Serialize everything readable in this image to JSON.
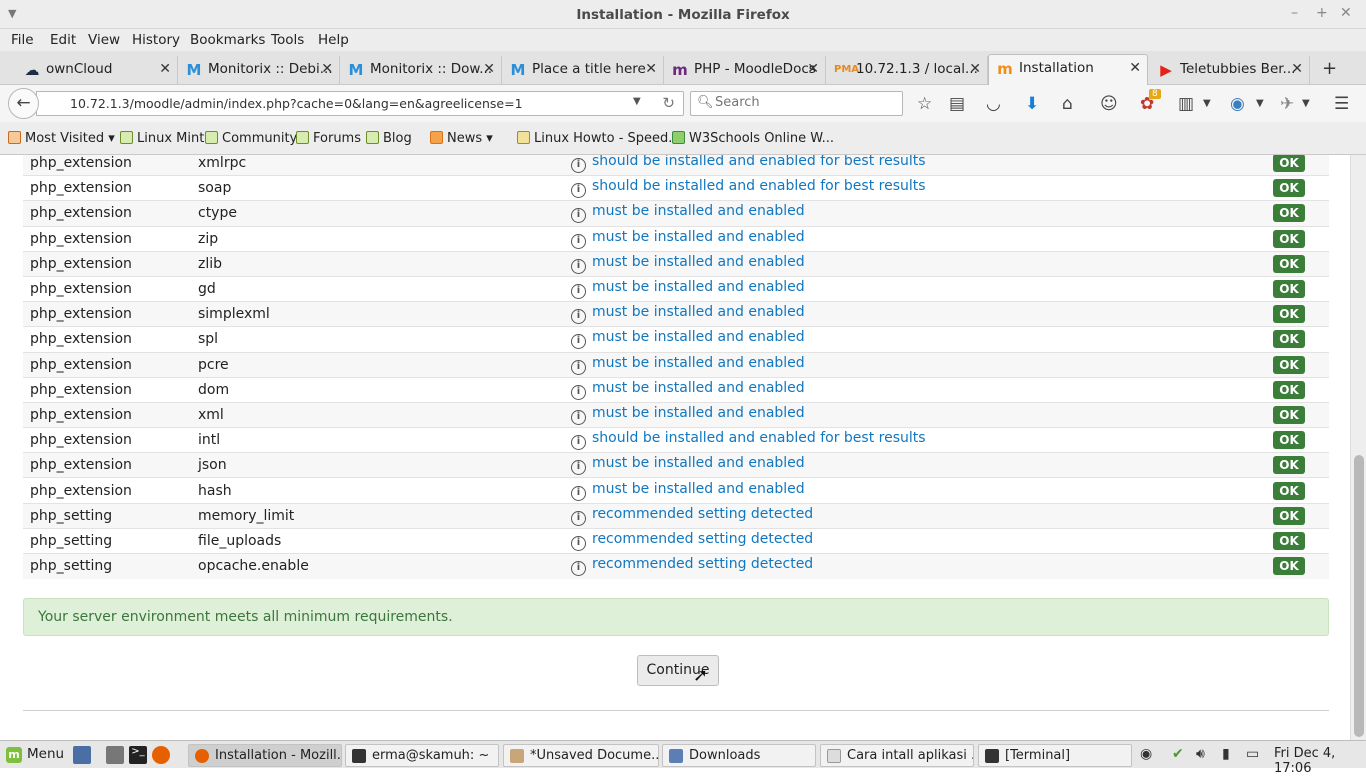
{
  "window": {
    "title": "Installation - Mozilla Firefox"
  },
  "menubar": [
    "File",
    "Edit",
    "View",
    "History",
    "Bookmarks",
    "Tools",
    "Help"
  ],
  "tabs": [
    {
      "label": "ownCloud",
      "icon": "cloud-icon"
    },
    {
      "label": "Monitorix :: Debi...",
      "icon": "monitorix-icon"
    },
    {
      "label": "Monitorix :: Dow...",
      "icon": "monitorix-icon"
    },
    {
      "label": "Place a title here",
      "icon": "monitorix-icon"
    },
    {
      "label": "PHP - MoodleDocs",
      "icon": "moodledocs-icon"
    },
    {
      "label": "10.72.1.3 / local...",
      "icon": "phpmyadmin-icon"
    },
    {
      "label": "Installation",
      "icon": "moodle-icon",
      "active": true
    },
    {
      "label": "Teletubbies Ber...",
      "icon": "youtube-icon"
    }
  ],
  "navbar": {
    "url": "10.72.1.3/moodle/admin/index.php?cache=0&lang=en&agreelicense=1",
    "search_placeholder": "Search",
    "badge_count": "8"
  },
  "bookmarks": [
    "Most Visited",
    "Linux Mint",
    "Community",
    "Forums",
    "Blog",
    "News",
    "Linux Howto - Speed...",
    "W3Schools Online W..."
  ],
  "requirements": [
    {
      "type": "php_extension",
      "name": "xmlrpc",
      "status": "should be installed and enabled for best results",
      "result": "OK"
    },
    {
      "type": "php_extension",
      "name": "soap",
      "status": "should be installed and enabled for best results",
      "result": "OK"
    },
    {
      "type": "php_extension",
      "name": "ctype",
      "status": "must be installed and enabled",
      "result": "OK"
    },
    {
      "type": "php_extension",
      "name": "zip",
      "status": "must be installed and enabled",
      "result": "OK"
    },
    {
      "type": "php_extension",
      "name": "zlib",
      "status": "must be installed and enabled",
      "result": "OK"
    },
    {
      "type": "php_extension",
      "name": "gd",
      "status": "must be installed and enabled",
      "result": "OK"
    },
    {
      "type": "php_extension",
      "name": "simplexml",
      "status": "must be installed and enabled",
      "result": "OK"
    },
    {
      "type": "php_extension",
      "name": "spl",
      "status": "must be installed and enabled",
      "result": "OK"
    },
    {
      "type": "php_extension",
      "name": "pcre",
      "status": "must be installed and enabled",
      "result": "OK"
    },
    {
      "type": "php_extension",
      "name": "dom",
      "status": "must be installed and enabled",
      "result": "OK"
    },
    {
      "type": "php_extension",
      "name": "xml",
      "status": "must be installed and enabled",
      "result": "OK"
    },
    {
      "type": "php_extension",
      "name": "intl",
      "status": "should be installed and enabled for best results",
      "result": "OK"
    },
    {
      "type": "php_extension",
      "name": "json",
      "status": "must be installed and enabled",
      "result": "OK"
    },
    {
      "type": "php_extension",
      "name": "hash",
      "status": "must be installed and enabled",
      "result": "OK"
    },
    {
      "type": "php_setting",
      "name": "memory_limit",
      "status": "recommended setting detected",
      "result": "OK"
    },
    {
      "type": "php_setting",
      "name": "file_uploads",
      "status": "recommended setting detected",
      "result": "OK"
    },
    {
      "type": "php_setting",
      "name": "opcache.enable",
      "status": "recommended setting detected",
      "result": "OK"
    }
  ],
  "notice": "Your server environment meets all minimum requirements.",
  "continue_label": "Continue",
  "taskbar": {
    "menu_label": "Menu",
    "windows": [
      {
        "label": "Installation - Mozill...",
        "active": true
      },
      {
        "label": "erma@skamuh: ~"
      },
      {
        "label": "*Unsaved Docume..."
      },
      {
        "label": "Downloads"
      },
      {
        "label": "Cara intall aplikasi ..."
      },
      {
        "label": "[Terminal]"
      }
    ],
    "clock": "Fri Dec  4, 17:06"
  }
}
